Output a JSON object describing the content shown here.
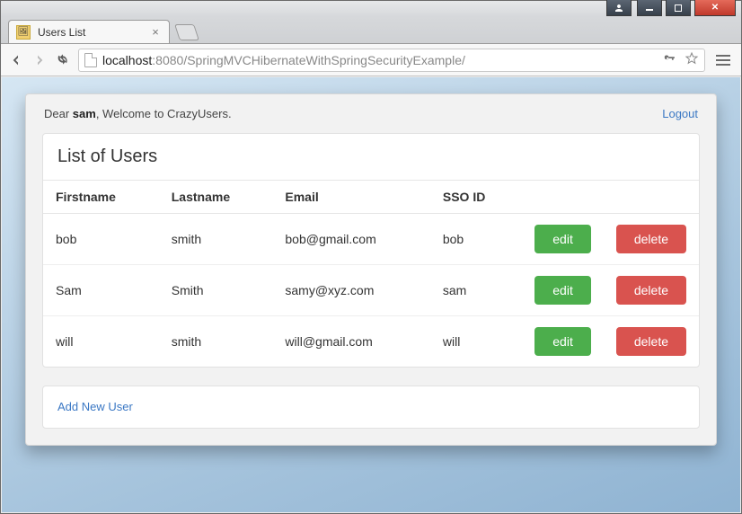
{
  "browser": {
    "tab_title": "Users List",
    "url_host": "localhost",
    "url_port": "8080",
    "url_path": "/SpringMVCHibernateWithSpringSecurityExample/"
  },
  "greeting": {
    "prefix": "Dear ",
    "username": "sam",
    "suffix": ", Welcome to CrazyUsers."
  },
  "logout_label": "Logout",
  "list_title": "List of Users ",
  "columns": {
    "firstname": "Firstname",
    "lastname": "Lastname",
    "email": "Email",
    "sso": "SSO ID"
  },
  "action_labels": {
    "edit": "edit",
    "delete": "delete"
  },
  "users": [
    {
      "firstname": "bob",
      "lastname": "smith",
      "email": "bob@gmail.com",
      "sso": "bob"
    },
    {
      "firstname": "Sam",
      "lastname": "Smith",
      "email": "samy@xyz.com",
      "sso": "sam"
    },
    {
      "firstname": "will",
      "lastname": "smith",
      "email": "will@gmail.com",
      "sso": "will"
    }
  ],
  "add_new_label": "Add New User"
}
